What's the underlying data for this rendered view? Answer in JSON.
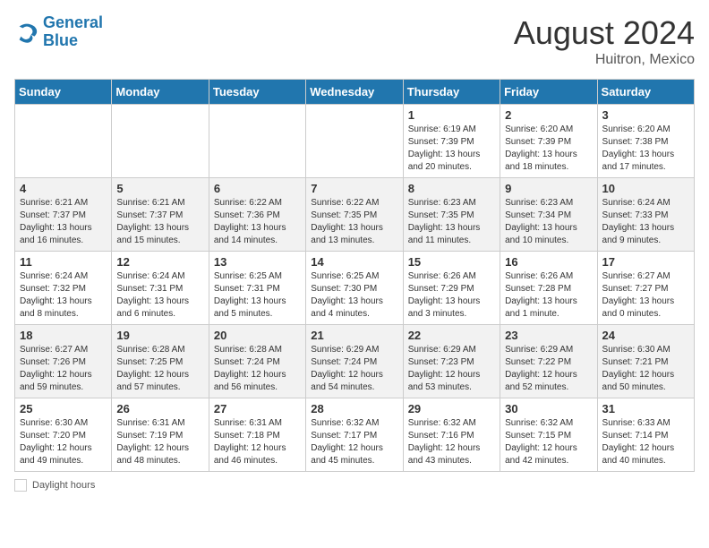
{
  "header": {
    "logo_general": "General",
    "logo_blue": "Blue",
    "month_year": "August 2024",
    "location": "Huitron, Mexico"
  },
  "days_of_week": [
    "Sunday",
    "Monday",
    "Tuesday",
    "Wednesday",
    "Thursday",
    "Friday",
    "Saturday"
  ],
  "footer": {
    "label": "Daylight hours"
  },
  "weeks": [
    [
      {
        "day": "",
        "info": ""
      },
      {
        "day": "",
        "info": ""
      },
      {
        "day": "",
        "info": ""
      },
      {
        "day": "",
        "info": ""
      },
      {
        "day": "1",
        "info": "Sunrise: 6:19 AM\nSunset: 7:39 PM\nDaylight: 13 hours\nand 20 minutes."
      },
      {
        "day": "2",
        "info": "Sunrise: 6:20 AM\nSunset: 7:39 PM\nDaylight: 13 hours\nand 18 minutes."
      },
      {
        "day": "3",
        "info": "Sunrise: 6:20 AM\nSunset: 7:38 PM\nDaylight: 13 hours\nand 17 minutes."
      }
    ],
    [
      {
        "day": "4",
        "info": "Sunrise: 6:21 AM\nSunset: 7:37 PM\nDaylight: 13 hours\nand 16 minutes."
      },
      {
        "day": "5",
        "info": "Sunrise: 6:21 AM\nSunset: 7:37 PM\nDaylight: 13 hours\nand 15 minutes."
      },
      {
        "day": "6",
        "info": "Sunrise: 6:22 AM\nSunset: 7:36 PM\nDaylight: 13 hours\nand 14 minutes."
      },
      {
        "day": "7",
        "info": "Sunrise: 6:22 AM\nSunset: 7:35 PM\nDaylight: 13 hours\nand 13 minutes."
      },
      {
        "day": "8",
        "info": "Sunrise: 6:23 AM\nSunset: 7:35 PM\nDaylight: 13 hours\nand 11 minutes."
      },
      {
        "day": "9",
        "info": "Sunrise: 6:23 AM\nSunset: 7:34 PM\nDaylight: 13 hours\nand 10 minutes."
      },
      {
        "day": "10",
        "info": "Sunrise: 6:24 AM\nSunset: 7:33 PM\nDaylight: 13 hours\nand 9 minutes."
      }
    ],
    [
      {
        "day": "11",
        "info": "Sunrise: 6:24 AM\nSunset: 7:32 PM\nDaylight: 13 hours\nand 8 minutes."
      },
      {
        "day": "12",
        "info": "Sunrise: 6:24 AM\nSunset: 7:31 PM\nDaylight: 13 hours\nand 6 minutes."
      },
      {
        "day": "13",
        "info": "Sunrise: 6:25 AM\nSunset: 7:31 PM\nDaylight: 13 hours\nand 5 minutes."
      },
      {
        "day": "14",
        "info": "Sunrise: 6:25 AM\nSunset: 7:30 PM\nDaylight: 13 hours\nand 4 minutes."
      },
      {
        "day": "15",
        "info": "Sunrise: 6:26 AM\nSunset: 7:29 PM\nDaylight: 13 hours\nand 3 minutes."
      },
      {
        "day": "16",
        "info": "Sunrise: 6:26 AM\nSunset: 7:28 PM\nDaylight: 13 hours\nand 1 minute."
      },
      {
        "day": "17",
        "info": "Sunrise: 6:27 AM\nSunset: 7:27 PM\nDaylight: 13 hours\nand 0 minutes."
      }
    ],
    [
      {
        "day": "18",
        "info": "Sunrise: 6:27 AM\nSunset: 7:26 PM\nDaylight: 12 hours\nand 59 minutes."
      },
      {
        "day": "19",
        "info": "Sunrise: 6:28 AM\nSunset: 7:25 PM\nDaylight: 12 hours\nand 57 minutes."
      },
      {
        "day": "20",
        "info": "Sunrise: 6:28 AM\nSunset: 7:24 PM\nDaylight: 12 hours\nand 56 minutes."
      },
      {
        "day": "21",
        "info": "Sunrise: 6:29 AM\nSunset: 7:24 PM\nDaylight: 12 hours\nand 54 minutes."
      },
      {
        "day": "22",
        "info": "Sunrise: 6:29 AM\nSunset: 7:23 PM\nDaylight: 12 hours\nand 53 minutes."
      },
      {
        "day": "23",
        "info": "Sunrise: 6:29 AM\nSunset: 7:22 PM\nDaylight: 12 hours\nand 52 minutes."
      },
      {
        "day": "24",
        "info": "Sunrise: 6:30 AM\nSunset: 7:21 PM\nDaylight: 12 hours\nand 50 minutes."
      }
    ],
    [
      {
        "day": "25",
        "info": "Sunrise: 6:30 AM\nSunset: 7:20 PM\nDaylight: 12 hours\nand 49 minutes."
      },
      {
        "day": "26",
        "info": "Sunrise: 6:31 AM\nSunset: 7:19 PM\nDaylight: 12 hours\nand 48 minutes."
      },
      {
        "day": "27",
        "info": "Sunrise: 6:31 AM\nSunset: 7:18 PM\nDaylight: 12 hours\nand 46 minutes."
      },
      {
        "day": "28",
        "info": "Sunrise: 6:32 AM\nSunset: 7:17 PM\nDaylight: 12 hours\nand 45 minutes."
      },
      {
        "day": "29",
        "info": "Sunrise: 6:32 AM\nSunset: 7:16 PM\nDaylight: 12 hours\nand 43 minutes."
      },
      {
        "day": "30",
        "info": "Sunrise: 6:32 AM\nSunset: 7:15 PM\nDaylight: 12 hours\nand 42 minutes."
      },
      {
        "day": "31",
        "info": "Sunrise: 6:33 AM\nSunset: 7:14 PM\nDaylight: 12 hours\nand 40 minutes."
      }
    ]
  ]
}
